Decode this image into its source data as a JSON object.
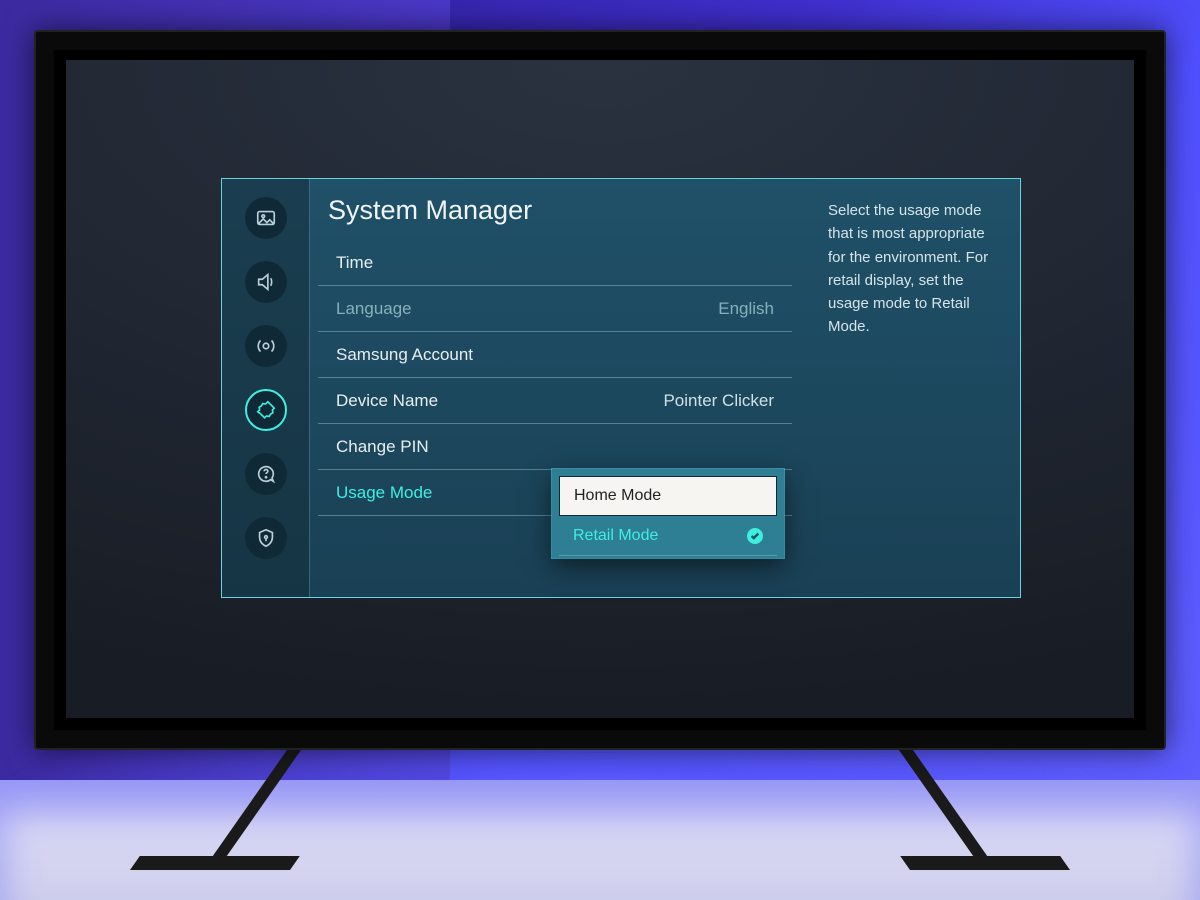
{
  "page_title": "System Manager",
  "sidebar": {
    "icons": [
      "picture",
      "sound",
      "broadcast",
      "system",
      "support",
      "privacy"
    ],
    "active_index": 3
  },
  "rows": {
    "time": {
      "label": "Time",
      "value": ""
    },
    "language": {
      "label": "Language",
      "value": "English"
    },
    "samsung_acct": {
      "label": "Samsung Account",
      "value": ""
    },
    "device_name": {
      "label": "Device Name",
      "value": "Pointer Clicker"
    },
    "change_pin": {
      "label": "Change PIN",
      "value": ""
    },
    "usage_mode": {
      "label": "Usage Mode",
      "value": ""
    }
  },
  "usage_mode_popup": {
    "options": [
      {
        "label": "Home Mode",
        "focused": true,
        "checked": false
      },
      {
        "label": "Retail Mode",
        "focused": false,
        "checked": true
      }
    ]
  },
  "help_text": "Select the usage mode that is most appropriate for the environment. For retail display, set the usage mode to Retail Mode."
}
